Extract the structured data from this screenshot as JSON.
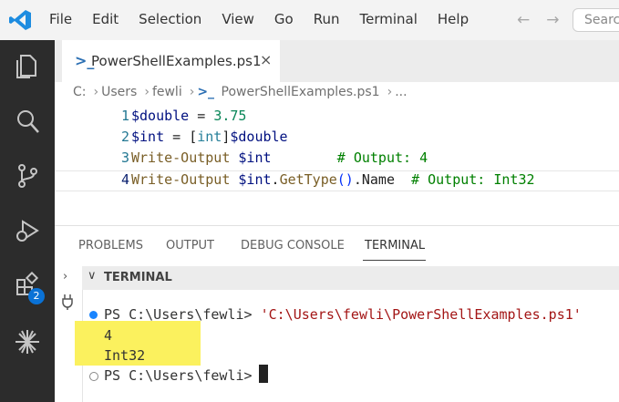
{
  "menu": [
    "File",
    "Edit",
    "Selection",
    "View",
    "Go",
    "Run",
    "Terminal",
    "Help"
  ],
  "search": {
    "placeholder": "Search"
  },
  "activity": {
    "extensions_badge": "2"
  },
  "tab": {
    "label": "PowerShellExamples.ps1",
    "close": "×",
    "icon": "powershell-file-icon"
  },
  "breadcrumb": {
    "drive": "C:",
    "folder1": "Users",
    "folder2": "fewli",
    "file": "PowerShellExamples.ps1",
    "more": "..."
  },
  "editor": {
    "line_numbers": [
      "1",
      "2",
      "3",
      "4"
    ],
    "lines": [
      "$double = 3.75",
      "$int = [int]$double",
      "Write-Output $int        # Output: 4",
      "Write-Output $int.GetType().Name  # Output: Int32"
    ]
  },
  "panel": {
    "tabs": [
      "PROBLEMS",
      "OUTPUT",
      "DEBUG CONSOLE",
      "TERMINAL"
    ],
    "active": "TERMINAL"
  },
  "terminal": {
    "header": "TERMINAL",
    "command_line": "PS C:\\Users\\fewli> . 'C:\\Users\\fewli\\PowerShellExamples.ps1'",
    "prompt_prefix": "PS C:\\Users\\fewli> ",
    "script_path": "'C:\\Users\\fewli\\PowerShellExamples.ps1'",
    "output": [
      "4",
      "Int32"
    ],
    "prompt": "PS C:\\Users\\fewli>"
  },
  "colors": {
    "accent": "#0a72d6",
    "highlight": "#fbf15e",
    "activity_bar": "#2c2c2c"
  }
}
